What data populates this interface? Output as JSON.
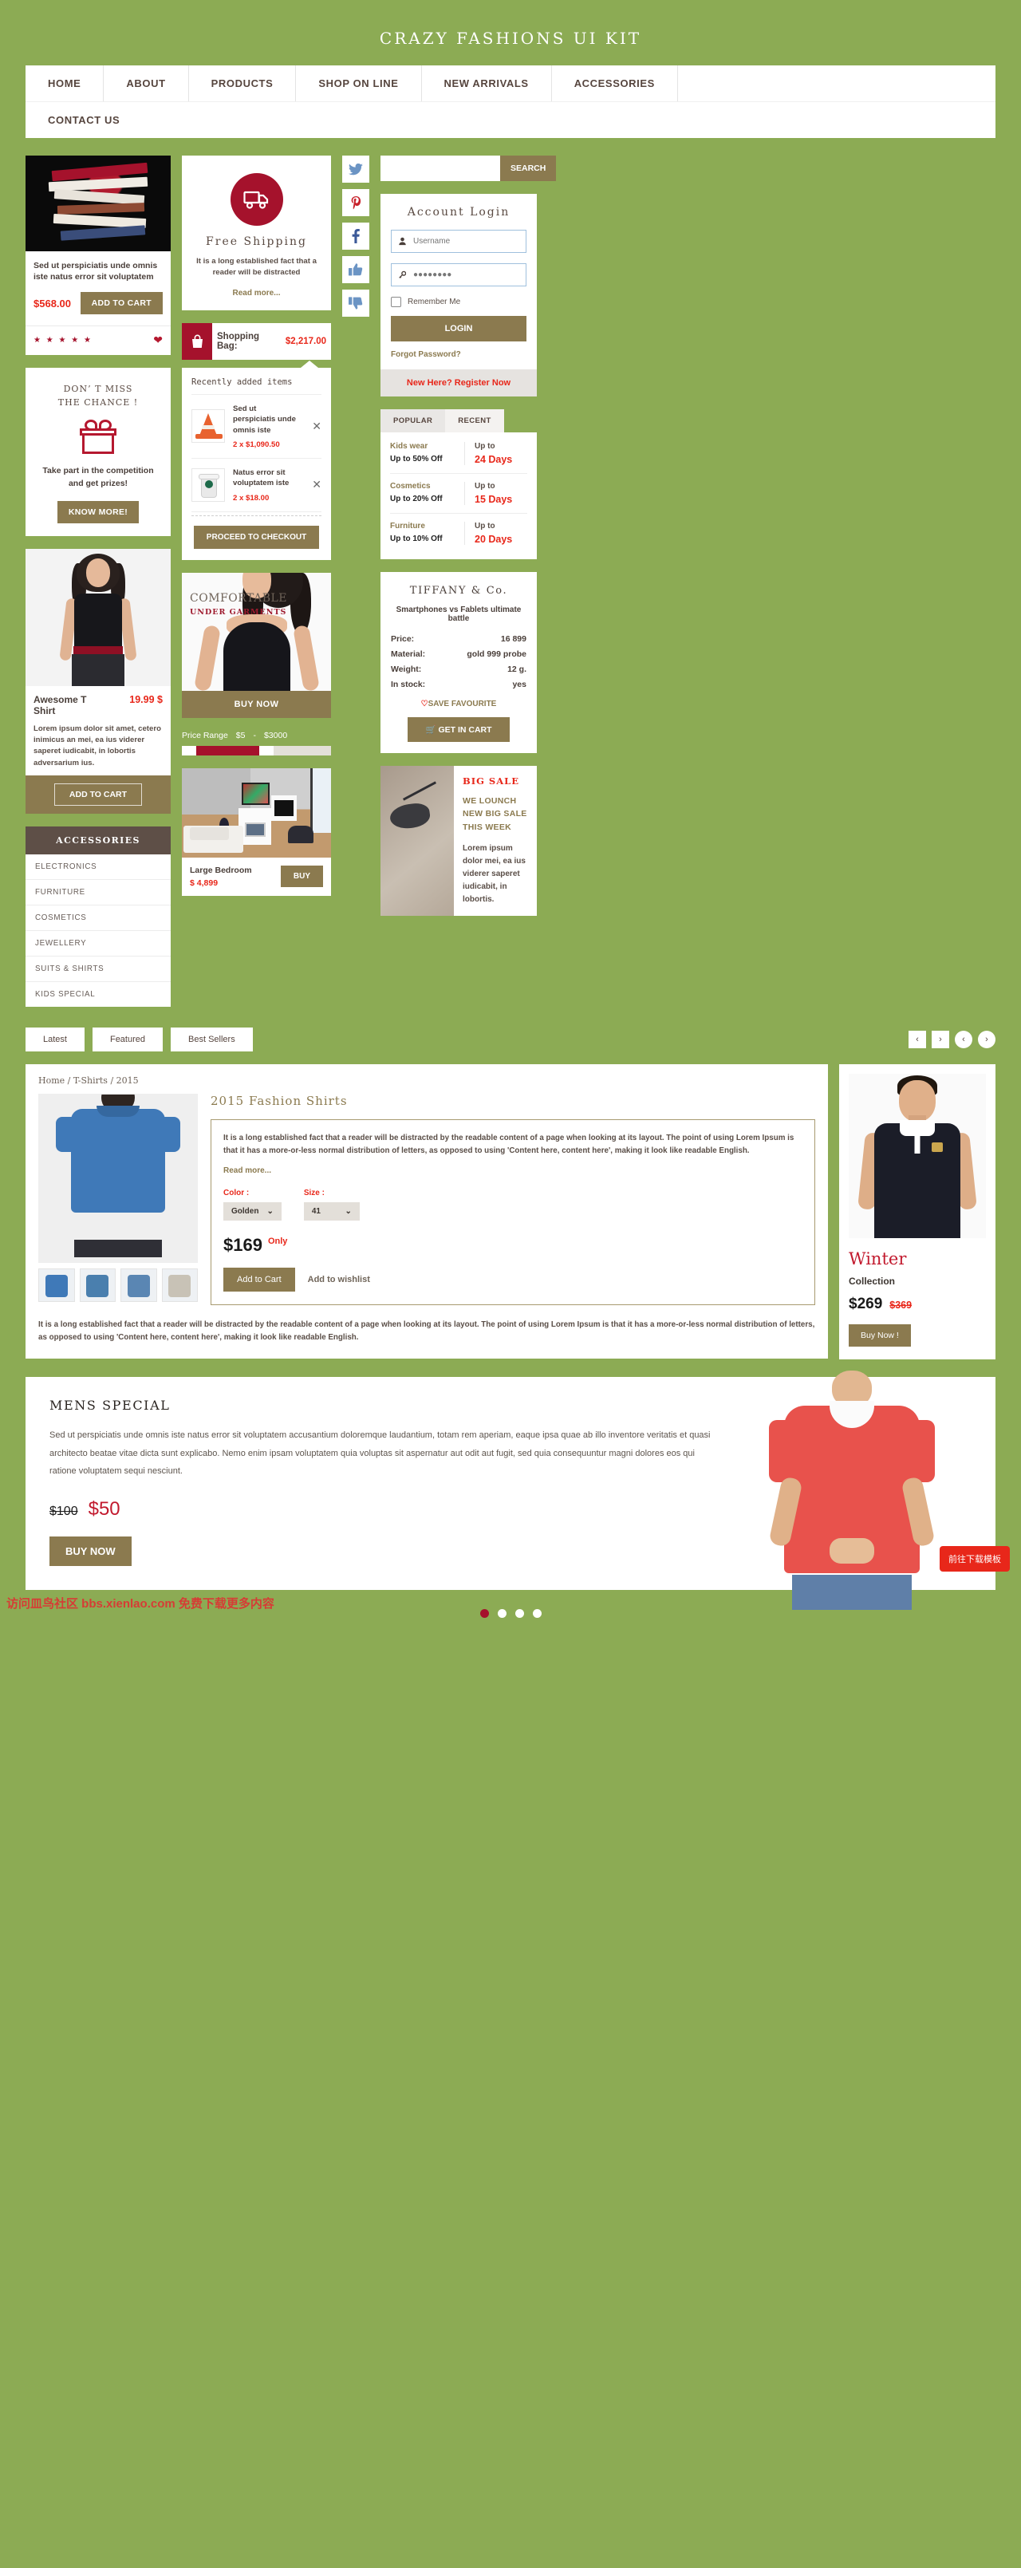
{
  "site": {
    "title": "CRAZY  FASHIONS  UI  KIT"
  },
  "nav": {
    "items": [
      "HOME",
      "ABOUT",
      "PRODUCTS",
      "SHOP ON LINE",
      "NEW ARRIVALS",
      "ACCESSORIES"
    ],
    "second_row": [
      "CONTACT US"
    ]
  },
  "product_card": {
    "title": "Sed ut perspiciatis unde omnis iste natus error sit voluptatem",
    "price": "$568.00",
    "add_to_cart": "ADD TO CART",
    "stars": "★ ★ ★ ★ ★"
  },
  "gift": {
    "line1": "DON’ T MISS",
    "line2": "THE CHANCE !",
    "subtitle": "Take part in the competition and get prizes!",
    "button": "KNOW MORE!"
  },
  "tshirt": {
    "name": "Awesome T Shirt",
    "price": "19.99 $",
    "desc": "Lorem ipsum dolor sit amet, cetero inimicus an mei, ea ius viderer saperet iudicabit, in lobortis adversarium ius.",
    "button": "ADD TO CART"
  },
  "accessories": {
    "heading": "ACCESSORIES",
    "items": [
      "ELECTRONICS",
      "FURNITURE",
      "COSMETICS",
      "JEWELLERY",
      "SUITS & SHIRTS",
      "KIDS SPECIAL"
    ]
  },
  "free_shipping": {
    "title": "Free Shipping",
    "text": "It is a long established fact that a reader will be distracted",
    "read_more": "Read more..."
  },
  "social": [
    {
      "name": "twitter-icon",
      "glyph": "t"
    },
    {
      "name": "pinterest-icon",
      "glyph": "P"
    },
    {
      "name": "facebook-icon",
      "glyph": "f"
    },
    {
      "name": "thumbs-up-icon",
      "glyph": "u"
    },
    {
      "name": "thumbs-down-icon",
      "glyph": "d"
    }
  ],
  "bag": {
    "label": "Shopping Bag:",
    "total": "$2,217.00",
    "recent_heading": "Recently added items",
    "items": [
      {
        "name": "Sed ut perspiciatis unde omnis iste",
        "qty_price": "2 x $1,090.50"
      },
      {
        "name": "Natus error sit voluptatem iste",
        "qty_price": "2 x $18.00"
      }
    ],
    "checkout": "PROCEED TO CHECKOUT"
  },
  "lady_banner": {
    "line1": "COMFORTABLE",
    "line2": "UNDER  GARMENTS",
    "button": "BUY NOW"
  },
  "price_range": {
    "label": "Price Range",
    "min": "$5",
    "dash": "-",
    "max": "$3000"
  },
  "bedroom": {
    "name": "Large Bedroom",
    "price": "$ 4,899",
    "button": "BUY"
  },
  "search": {
    "placeholder": "",
    "button": "SEARCH"
  },
  "login": {
    "title": "Account Login",
    "username_placeholder": "Username",
    "password_value": "●●●●●●●●",
    "remember": "Remember Me",
    "login_button": "LOGIN",
    "forgot": "Forgot Password?",
    "register": "New Here? Register Now"
  },
  "deals": {
    "tabs": [
      "POPULAR",
      "RECENT"
    ],
    "rows": [
      {
        "category": "Kids wear",
        "offer": "Up to 50% Off",
        "upto": "Up to",
        "days": "24 Days"
      },
      {
        "category": "Cosmetics",
        "offer": "Up to 20% Off",
        "upto": "Up to",
        "days": "15 Days"
      },
      {
        "category": "Furniture",
        "offer": "Up to 10% Off",
        "upto": "Up to",
        "days": "20 Days"
      }
    ]
  },
  "tiffany": {
    "title": "TIFFANY  &  Co.",
    "subtitle": "Smartphones vs Fablets ultimate battle",
    "specs": [
      {
        "label": "Price:",
        "value": "16 899"
      },
      {
        "label": "Material:",
        "value": "gold 999 probe"
      },
      {
        "label": "Weight:",
        "value": "12 g."
      },
      {
        "label": "In stock:",
        "value": "yes"
      }
    ],
    "favourite": "SAVE FAVOURITE",
    "button": "GET IN CART"
  },
  "big_sale": {
    "tag": "BIG  SALE",
    "heading": "WE LOUNCH NEW BIG SALE THIS WEEK",
    "text": "Lorem ipsum dolor mei, ea ius viderer saperet iudicabit, in lobortis."
  },
  "filters": {
    "buttons": [
      "Latest",
      "Featured",
      "Best Sellers"
    ],
    "arrows": [
      "‹",
      "›",
      "‹",
      "›"
    ]
  },
  "detail": {
    "breadcrumb": "Home  /  T-Shirts  /  2015",
    "title": "2015 Fashion Shirts",
    "description": "It is a long established fact that a reader will be distracted by the readable content of a page when looking at its layout. The point of using Lorem Ipsum is that it has a more-or-less normal distribution of letters, as opposed to using 'Content here, content here', making it look like readable English.",
    "read_more": "Read more...",
    "color_label": "Color :",
    "color_value": "Golden",
    "size_label": "Size :",
    "size_value": "41",
    "price": "$169",
    "only": "Only",
    "add_to_cart": "Add to Cart",
    "wishlist": "Add to wishlist",
    "footer_text": "It is a long established fact that a reader will be distracted by the readable content of a page when looking at its layout. The point of using Lorem Ipsum is that it has a more-or-less normal distribution of letters, as opposed to using 'Content here, content here', making it look like readable English."
  },
  "side_product": {
    "winter": "Winter",
    "collection": "Collection",
    "price": "$269",
    "old_price": "$369",
    "button": "Buy Now !"
  },
  "mens": {
    "title": "MENS  SPECIAL",
    "text": "Sed ut perspiciatis unde omnis iste natus error sit voluptatem accusantium doloremque laudantium, totam rem aperiam, eaque ipsa quae ab illo inventore veritatis et quasi architecto beatae vitae dicta sunt explicabo. Nemo enim ipsam voluptatem quia voluptas sit aspernatur aut odit aut fugit, sed quia consequuntur magni dolores eos qui ratione voluptatem sequi nesciunt.",
    "old_price": "$100",
    "new_price": "$50",
    "button": "BUY NOW"
  },
  "footer": {
    "watermark": "访问皿鸟社区 bbs.xienlao.com 免费下载更多内容",
    "download_badge": "前往下载模板"
  },
  "colors": {
    "page_bg": "#8cab54",
    "gold": "#8b7a4f",
    "crimson": "#a5122c",
    "red": "#e8271a",
    "dark_brown": "#5e4f47"
  }
}
